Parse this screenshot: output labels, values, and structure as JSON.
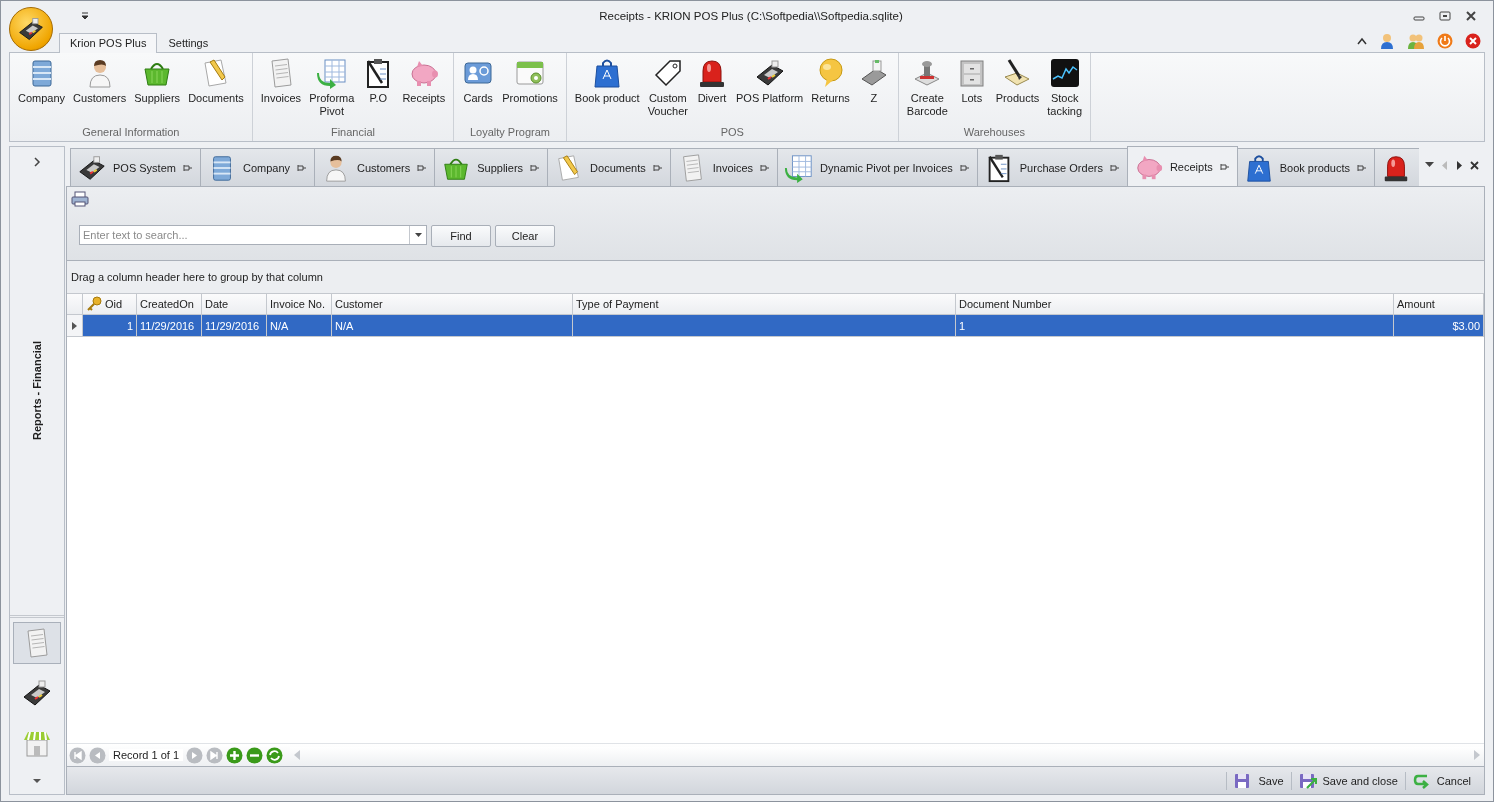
{
  "window": {
    "title": "Receipts - KRION POS Plus (C:\\Softpedia\\\\Softpedia.sqlite)"
  },
  "ribbon": {
    "tabs": [
      {
        "label": "Krion POS Plus",
        "selected": true
      },
      {
        "label": "Settings",
        "selected": false
      }
    ],
    "groups": [
      {
        "label": "General Information",
        "buttons": [
          "Company",
          "Customers",
          "Suppliers",
          "Documents"
        ]
      },
      {
        "label": "Financial",
        "buttons": [
          "Invoices",
          "Proforma\nPivot",
          "P.O",
          "Receipts"
        ]
      },
      {
        "label": "Loyalty Program",
        "buttons": [
          "Cards",
          "Promotions"
        ]
      },
      {
        "label": "POS",
        "buttons": [
          "Book product",
          "Custom\nVoucher",
          "Divert",
          "POS Platform",
          "Returns",
          "Z"
        ]
      },
      {
        "label": "Warehouses",
        "buttons": [
          "Create\nBarcode",
          "Lots",
          "Products",
          "Stock\ntacking"
        ]
      }
    ]
  },
  "sidebar": {
    "title": "Reports - Financial",
    "nav_items": [
      {
        "selected": true
      },
      {
        "selected": false
      },
      {
        "selected": false
      }
    ]
  },
  "doc_tabs": [
    {
      "label": "POS System",
      "selected": false
    },
    {
      "label": "Company",
      "selected": false
    },
    {
      "label": "Customers",
      "selected": false
    },
    {
      "label": "Suppliers",
      "selected": false
    },
    {
      "label": "Documents",
      "selected": false
    },
    {
      "label": "Invoices",
      "selected": false
    },
    {
      "label": "Dynamic Pivot per Invoices",
      "selected": false
    },
    {
      "label": "Purchase Orders",
      "selected": false
    },
    {
      "label": "Receipts",
      "selected": true
    },
    {
      "label": "Book products",
      "selected": false
    },
    {
      "selected": false
    }
  ],
  "search": {
    "placeholder": "Enter text to search...",
    "buttons": [
      "Find",
      "Clear"
    ]
  },
  "group_panel": "Drag a column header here to group by that column",
  "grid": {
    "columns": [
      "Oid",
      "CreatedOn",
      "Date",
      "Invoice No.",
      "Customer",
      "Type of Payment",
      "Document Number",
      "Amount"
    ],
    "rows": [
      {
        "selected": true,
        "cells": [
          "1",
          "11/29/2016",
          "11/29/2016",
          "N/A",
          "N/A",
          null,
          "1",
          "$3.00"
        ]
      }
    ]
  },
  "navigator": {
    "text": "Record 1 of 1"
  },
  "actions": [
    "Save",
    "Save and close",
    "Cancel"
  ]
}
